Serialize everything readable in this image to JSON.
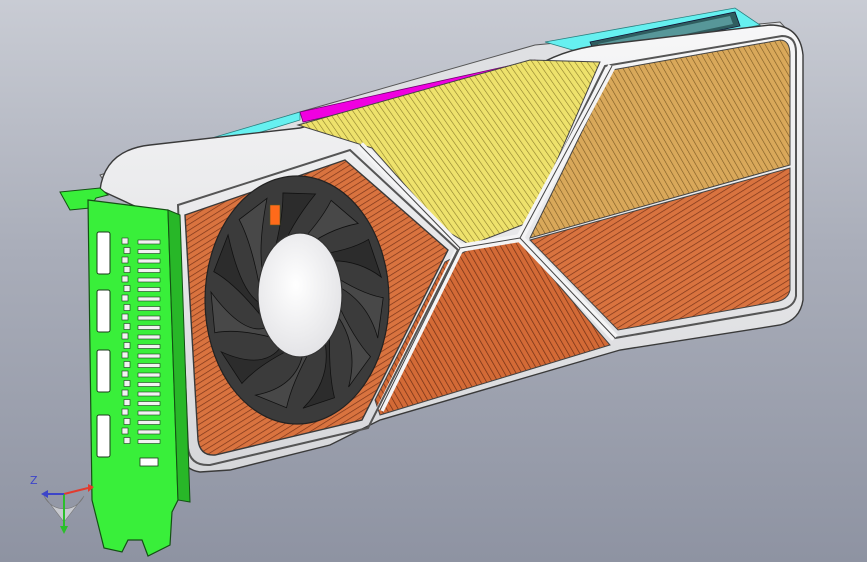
{
  "viewport": {
    "background_top": "#c9ccd4",
    "background_bottom": "#8e93a2"
  },
  "model": {
    "type": "graphics-card-3d-model",
    "colors": {
      "bracket": "#39ef3a",
      "heatsink_copper": "#d9733f",
      "heatsink_yellow": "#eee26c",
      "top_stripe": "#f000e0",
      "shroud": "#ececee",
      "accent_cyan": "#66f0f0",
      "fan_blade": "#2c2c2c",
      "fan_hub": "#f4f4f4"
    },
    "fan_blade_count": 11
  },
  "triad": {
    "z_label": "Z",
    "x_color": "#e23b2e",
    "y_color": "#2bbf2b",
    "z_color": "#3d45c9"
  }
}
